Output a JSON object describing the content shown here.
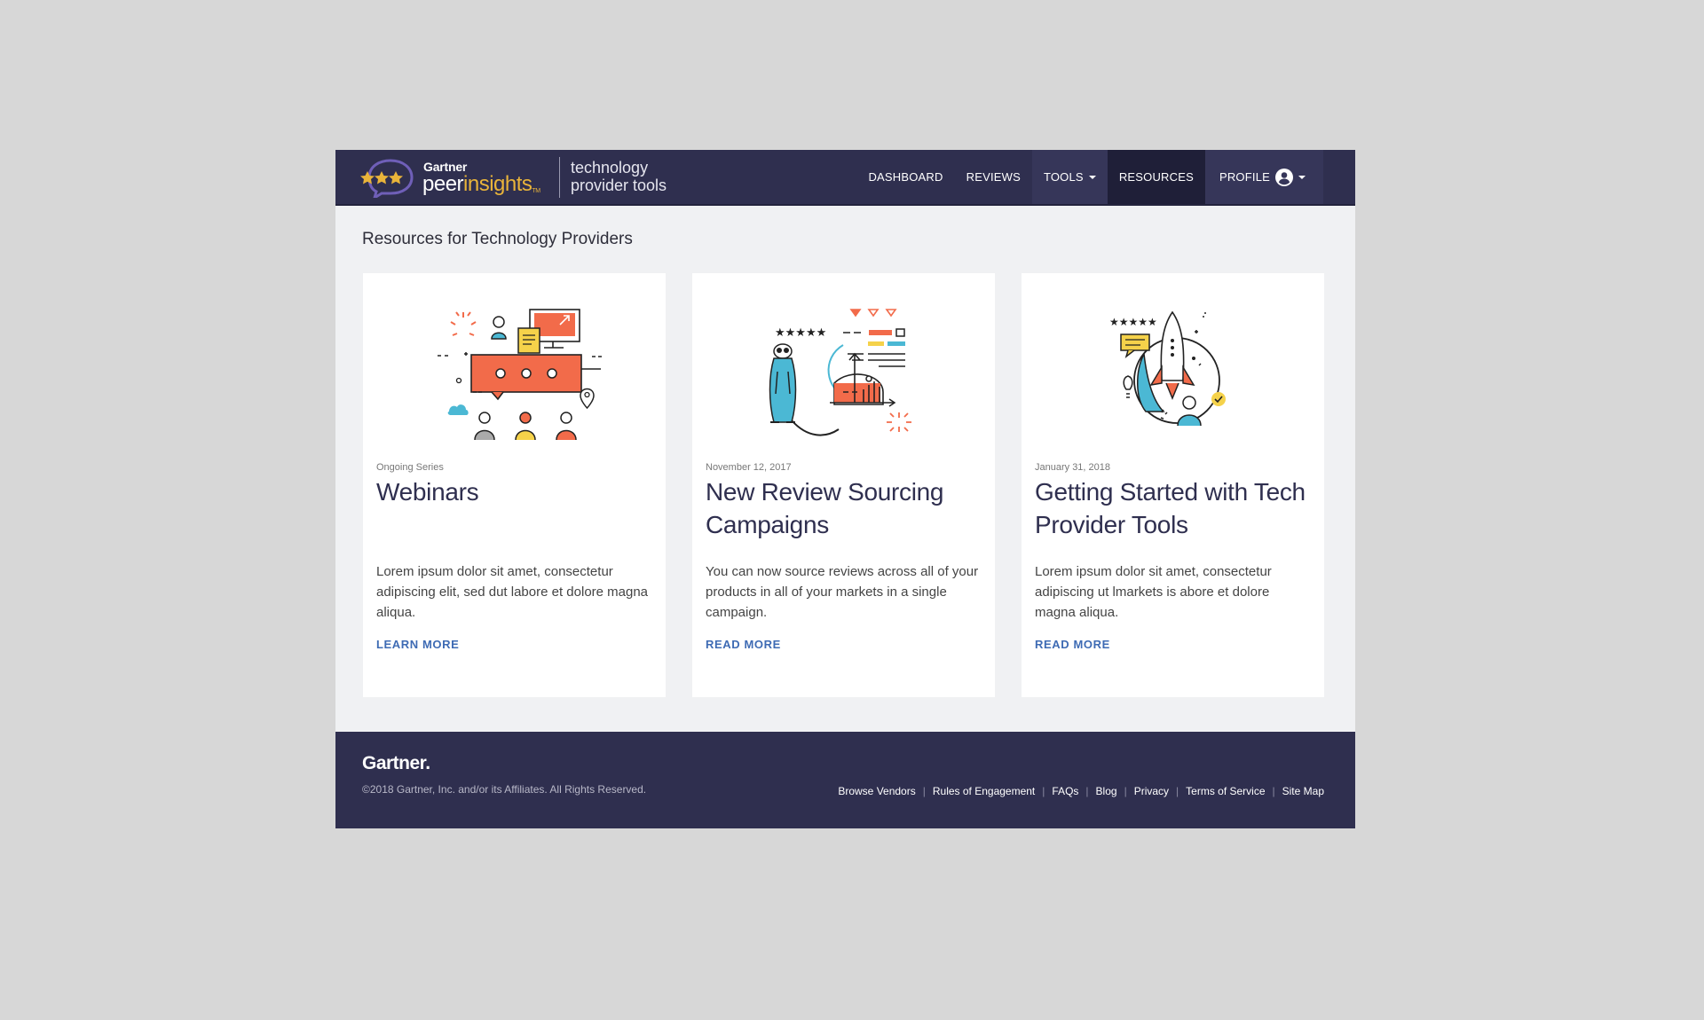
{
  "brand": {
    "gartner": "Gartner",
    "peer_a": "peer",
    "peer_b": "insights",
    "tm": "TM",
    "subtitle_line1": "technology",
    "subtitle_line2": "provider tools",
    "star_color": "#e9b43a"
  },
  "nav": {
    "items": [
      {
        "label": "DASHBOARD"
      },
      {
        "label": "REVIEWS"
      },
      {
        "label": "TOOLS"
      },
      {
        "label": "RESOURCES"
      },
      {
        "label": "PROFILE"
      }
    ]
  },
  "page": {
    "title": "Resources for Technology Providers"
  },
  "cards": [
    {
      "meta": "Ongoing Series",
      "title": "Webinars",
      "desc": "Lorem ipsum dolor sit amet, consectetur adipiscing elit, sed dut labore et dolore magna aliqua.",
      "link": "LEARN MORE",
      "illustration": "webinar-illustration"
    },
    {
      "meta": "November 12, 2017",
      "title": "New Review Sourcing Campaigns",
      "desc": "You can now source reviews across all of your products in all of your markets in a single campaign.",
      "link": "READ MORE",
      "illustration": "meerkat-chart-illustration"
    },
    {
      "meta": "January 31, 2018",
      "title": "Getting Started with Tech Provider Tools",
      "desc": "Lorem ipsum dolor sit amet, consectetur adipiscing ut lmarkets is abore et dolore magna aliqua.",
      "link": "READ MORE",
      "illustration": "rocket-illustration"
    }
  ],
  "footer": {
    "logo": "Gartner.",
    "copyright": "©2018 Gartner, Inc. and/or its Affiliates. All Rights Reserved.",
    "links": [
      "Browse Vendors",
      "Rules of Engagement",
      "FAQs",
      "Blog",
      "Privacy",
      "Terms of Service",
      "Site Map"
    ]
  },
  "colors": {
    "navy": "#2f2f4f",
    "accent_orange": "#f26b4a",
    "accent_blue": "#4bb8d4",
    "accent_yellow": "#f5d24a",
    "link_blue": "#3e6bb4"
  }
}
